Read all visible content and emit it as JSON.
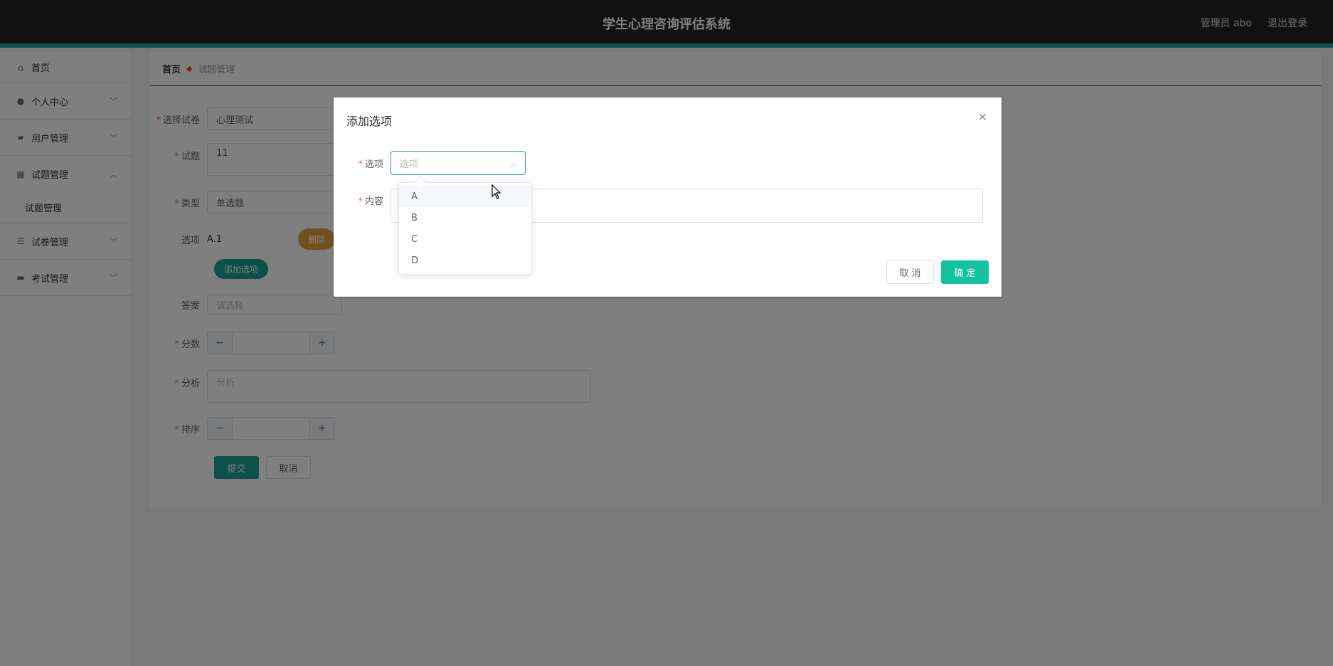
{
  "app": {
    "title": "学生心理咨询评估系统",
    "user": "管理员 abo",
    "logout": "退出登录"
  },
  "sidebar": {
    "items": [
      {
        "label": "首页",
        "icon": "home-icon"
      },
      {
        "label": "个人中心",
        "icon": "user-icon"
      },
      {
        "label": "用户管理",
        "icon": "briefcase-icon"
      },
      {
        "label": "试题管理",
        "icon": "grid-icon"
      },
      {
        "label": "试卷管理",
        "icon": "list-icon"
      },
      {
        "label": "考试管理",
        "icon": "ticket-icon"
      }
    ],
    "sub": "试题管理"
  },
  "breadcrumb": {
    "home": "首页",
    "current": "试题管理"
  },
  "form": {
    "paper_label": "选择试卷",
    "paper_value": "心理测试",
    "question_label": "试题",
    "question_value": "11",
    "type_label": "类型",
    "type_value": "单选题",
    "options_label": "选项",
    "option_value": "A.1",
    "delete_btn": "删除",
    "add_option_btn": "添加选项",
    "answer_label": "答案",
    "answer_placeholder": "请选择",
    "score_label": "分数",
    "analysis_label": "分析",
    "analysis_placeholder": "分析",
    "order_label": "排序",
    "submit": "提交",
    "cancel": "取消",
    "stepper_minus": "−",
    "stepper_plus": "+"
  },
  "dialog": {
    "title": "添加选项",
    "option_label": "选项",
    "option_placeholder": "选项",
    "content_label": "内容",
    "cancel": "取 消",
    "ok": "确 定"
  },
  "dropdown": {
    "items": [
      "A",
      "B",
      "C",
      "D"
    ]
  }
}
